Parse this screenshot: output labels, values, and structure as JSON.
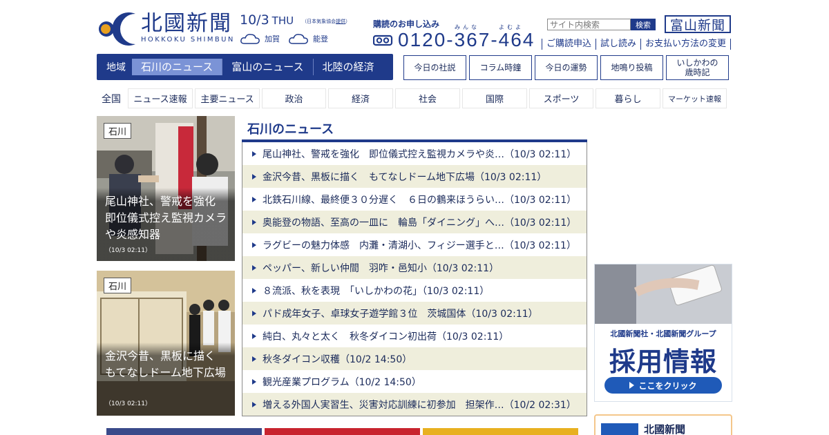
{
  "header": {
    "logo_name": "北國新聞",
    "logo_roman": "HOKKOKU SHIMBUN",
    "date": "10/3",
    "dow": "THU",
    "date_note_prefix": "（日本気象協会",
    "date_note_link": "提供",
    "date_note_suffix": "）",
    "weather": [
      {
        "region": "加賀",
        "icon": "cloud-icon"
      },
      {
        "region": "能登",
        "icon": "cloud-icon"
      }
    ],
    "subscribe_label": "購読のお申し込み",
    "subscribe_ruby": [
      "みんな",
      "よむよ"
    ],
    "phone_icon": "free-dial-icon",
    "phone": "0120-367-464",
    "search_placeholder": "サイト内検索",
    "search_button": "検索",
    "toyama_logo": "富山新聞",
    "links": [
      "ご購読申込",
      "試し読み",
      "お支払い方法の変更"
    ]
  },
  "region_nav": {
    "label": "地域",
    "tabs": [
      {
        "label": "石川のニュース",
        "active": true
      },
      {
        "label": "富山のニュース",
        "active": false
      },
      {
        "label": "北陸の経済",
        "active": false
      }
    ]
  },
  "feature_buttons": [
    "今日の社説",
    "コラム時鐘",
    "今日の運勢",
    "地鳴り投稿",
    "いしかわの\n歳時記"
  ],
  "category_nav": {
    "label": "全国",
    "items": [
      "ニュース速報",
      "主要ニュース",
      "政治",
      "経済",
      "社会",
      "国際",
      "スポーツ",
      "暮らし",
      "マーケット速報"
    ]
  },
  "photo_cards": [
    {
      "tag": "石川",
      "caption": "尾山神社、警戒を強化　即位儀式控え監視カメラや炎感知器",
      "time": "（10/3 02:11）"
    },
    {
      "tag": "石川",
      "caption": "金沢今昔、黒板に描く　もてなしドーム地下広場",
      "time": "（10/3 02:11）"
    }
  ],
  "news": {
    "title": "石川のニュース",
    "items": [
      "尾山神社、警戒を強化　即位儀式控え監視カメラや炎…（10/3 02:11）",
      "金沢今昔、黒板に描く　もてなしドーム地下広場（10/3 02:11）",
      "北鉄石川線、最終便３０分遅く　６日の鶴来ほうらい…（10/3 02:11）",
      "奥能登の物語、至高の一皿に　輪島「ダイニング」へ…（10/3 02:11）",
      "ラグビーの魅力体感　内灘・清湖小、フィジー選手と…（10/3 02:11）",
      "ペッパー、新しい仲間　羽咋・邑知小（10/3 02:11）",
      "８流派、秋を表現　「いしかわの花」（10/3 02:11）",
      "パド成年女子、卓球女子遊学館３位　茨城国体（10/3 02:11）",
      "純白、丸々と太く　秋冬ダイコン初出荷（10/3 02:11）",
      "秋冬ダイコン収穫（10/2 14:50）",
      "観光産業プログラム（10/2 14:50）",
      "増える外国人実習生、災害対応訓練に初参加　担架作…（10/2 02:31）"
    ]
  },
  "recruit_banner": {
    "subtitle": "北國新聞社・北國新聞グループ",
    "title": "採用情報",
    "button": "ここをクリック"
  },
  "side_box": {
    "text": "北國新聞"
  },
  "colors": {
    "brand": "#1f3a8a",
    "active_tab": "#7b93d6",
    "row_alt": "#efeedc"
  }
}
